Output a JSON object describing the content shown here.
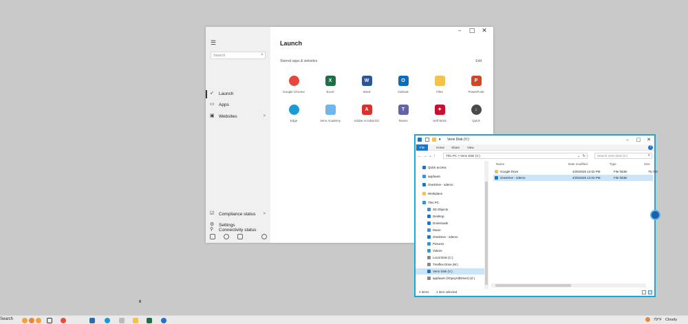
{
  "launch": {
    "search_placeholder": "Search",
    "nav": [
      {
        "label": "Launch"
      },
      {
        "label": "Apps"
      },
      {
        "label": "Websites",
        "chevron": ">"
      }
    ],
    "bottom_nav": [
      {
        "label": "Connectivity status"
      },
      {
        "label": "Compliance status",
        "chevron": ">"
      },
      {
        "label": "Settings"
      }
    ],
    "title": "Launch",
    "subtitle": "Starred apps & websites",
    "edit_label": "Edit",
    "apps": [
      {
        "label": "Google Chrome",
        "icon": "chrome-icon",
        "color": "#e8453c",
        "glyph": ""
      },
      {
        "label": "Excel",
        "icon": "excel-icon",
        "color": "#1d7044",
        "glyph": "X"
      },
      {
        "label": "Word",
        "icon": "word-icon",
        "color": "#2b5797",
        "glyph": "W"
      },
      {
        "label": "Outlook",
        "icon": "outlook-icon",
        "color": "#0f6cbd",
        "glyph": "O"
      },
      {
        "label": "Files",
        "icon": "folder-icon",
        "color": "#f2c14e",
        "glyph": ""
      },
      {
        "label": "PowerPoint",
        "icon": "powerpoint-icon",
        "color": "#d04727",
        "glyph": "P"
      },
      {
        "label": "Edge",
        "icon": "edge-icon",
        "color": "#1c9ad6",
        "glyph": ""
      },
      {
        "label": "Venn Academy",
        "icon": "academy-icon",
        "color": "#6fb7e8",
        "glyph": ""
      },
      {
        "label": "Adobe Acrobat DC",
        "icon": "acrobat-icon",
        "color": "#d8322a",
        "glyph": "A"
      },
      {
        "label": "Teams",
        "icon": "teams-icon",
        "color": "#6264a7",
        "glyph": "T"
      },
      {
        "label": "Self Work",
        "icon": "selfwork-icon",
        "color": "#c8102e",
        "glyph": "✦"
      },
      {
        "label": "Quick",
        "icon": "download-icon",
        "color": "#4a4a4a",
        "glyph": "↓"
      }
    ]
  },
  "explorer": {
    "title": "Venn Disk (V:)",
    "ribbon_tabs": [
      "File",
      "Home",
      "Share",
      "View"
    ],
    "address": "This PC  >  Venn Disk (V:)",
    "search_placeholder": "Search Venn Disk (V:)",
    "columns": [
      "Name",
      "Date modified",
      "Type",
      "Size"
    ],
    "files": [
      {
        "name": "Google Drive",
        "date": "4/25/2025 12:02 PM",
        "type": "File folder",
        "size": "76,720",
        "selected": false,
        "color": "#f2c14e"
      },
      {
        "name": "OneDrive - sdemo",
        "date": "4/25/2025 12:02 PM",
        "type": "File folder",
        "size": "",
        "selected": true,
        "color": "#1b76c9"
      }
    ],
    "nav": [
      {
        "label": "Quick access",
        "indent": 0,
        "color": "#1b76c9"
      },
      {
        "label": "appfuwin",
        "indent": 0,
        "color": "#3c8ed8"
      },
      {
        "label": "OneDrive - sdemo",
        "indent": 0,
        "color": "#1b76c9"
      },
      {
        "label": "Workplace",
        "indent": 0,
        "color": "#f2c14e"
      },
      {
        "label": "This PC",
        "indent": 0,
        "color": "#3c8ed8"
      },
      {
        "label": "3D Objects",
        "indent": 1,
        "color": "#3c8ed8"
      },
      {
        "label": "Desktop",
        "indent": 1,
        "color": "#1b76c9"
      },
      {
        "label": "Downloads",
        "indent": 1,
        "color": "#1b76c9"
      },
      {
        "label": "Music",
        "indent": 1,
        "color": "#3c8ed8"
      },
      {
        "label": "OneDrive - sdemo",
        "indent": 1,
        "color": "#1b76c9"
      },
      {
        "label": "Pictures",
        "indent": 1,
        "color": "#3c8ed8"
      },
      {
        "label": "Videos",
        "indent": 1,
        "color": "#3c8ed8"
      },
      {
        "label": "Local Disk (C:)",
        "indent": 1,
        "color": "#888888"
      },
      {
        "label": "Tresflex Drive (M:)",
        "indent": 1,
        "color": "#888888"
      },
      {
        "label": "Venn Disk (V:)",
        "indent": 1,
        "color": "#1b76c9",
        "selected": true
      },
      {
        "label": "appfuwin (\\\\GpxyVdDriver) (Z:)",
        "indent": 1,
        "color": "#888888"
      }
    ],
    "status_items": "2 items",
    "status_selected": "1 item selected"
  },
  "taskbar": {
    "search_text": "Search",
    "weather_temp": "79°F",
    "weather_text": "Cloudy"
  }
}
